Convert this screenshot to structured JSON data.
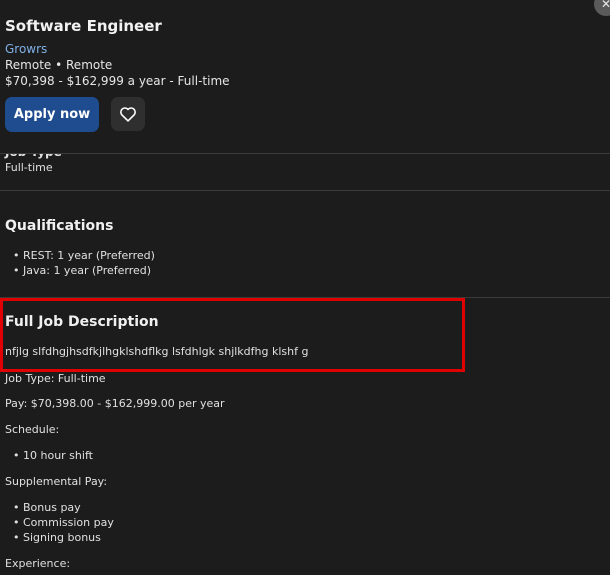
{
  "header": {
    "title": "Software Engineer",
    "company": "Growrs",
    "location": "Remote  •  Remote",
    "salary": "$70,398 - $162,999 a year  - Full-time",
    "apply_label": "Apply now",
    "save_icon": "heart-icon",
    "close_icon": "close-icon",
    "close_glyph": "✕"
  },
  "job_type_section": {
    "heading_partial": "Job Type",
    "value": "Full-time"
  },
  "qualifications": {
    "heading": "Qualifications",
    "items": [
      "REST: 1 year (Preferred)",
      "Java: 1 year (Preferred)"
    ]
  },
  "description": {
    "heading": "Full Job Description",
    "body": "nfjlg slfdhgjhsdfkjlhgklshdflkg lsfdhlgk shjlkdfhg klshf g",
    "job_type": "Job Type: Full-time",
    "pay": "Pay: $70,398.00 - $162,999.00 per year",
    "schedule_label": "Schedule:",
    "schedule_items": [
      "10 hour shift"
    ],
    "supplemental_label": "Supplemental Pay:",
    "supplemental_items": [
      "Bonus pay",
      "Commission pay",
      "Signing bonus"
    ],
    "experience_label": "Experience:"
  },
  "colors": {
    "background": "#1c1c1c",
    "accent": "#1f4c8f",
    "link": "#7fb0e6",
    "highlight": "#e00000"
  }
}
